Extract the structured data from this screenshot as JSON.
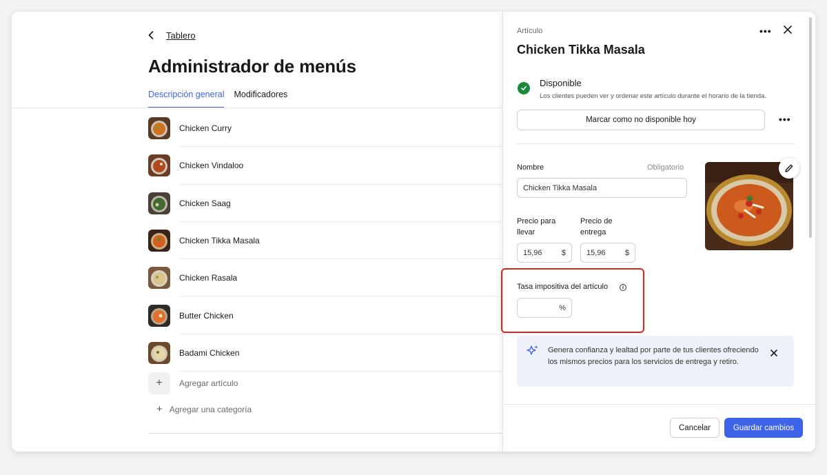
{
  "main": {
    "breadcrumb": "Tablero",
    "title": "Administrador de menús",
    "tabs": [
      {
        "label": "Descripción general",
        "active": true
      },
      {
        "label": "Modificadores",
        "active": false
      }
    ],
    "items": [
      {
        "name": "Chicken Curry"
      },
      {
        "name": "Chicken Vindaloo"
      },
      {
        "name": "Chicken Saag"
      },
      {
        "name": "Chicken Tikka Masala"
      },
      {
        "name": "Chicken Rasala"
      },
      {
        "name": "Butter Chicken"
      },
      {
        "name": "Badami Chicken"
      }
    ],
    "add_item": "Agregar artículo",
    "add_category": "Agregar una categoría"
  },
  "panel": {
    "overline": "Artículo",
    "title": "Chicken Tikka Masala",
    "availability": {
      "title": "Disponible",
      "description": "Los clientes pueden ver y ordenar este artículo durante el horario de la tienda."
    },
    "mark_unavailable_label": "Marcar como no disponible hoy",
    "name_field": {
      "label": "Nombre",
      "required": "Obligatorio",
      "value": "Chicken Tikka Masala"
    },
    "takeout_price": {
      "label_line1": "Precio para",
      "label_line2": "llevar",
      "value": "15,96",
      "suffix": "$"
    },
    "delivery_price": {
      "label_line1": "Precio de",
      "label_line2": "entrega",
      "value": "15,96",
      "suffix": "$"
    },
    "tax_rate": {
      "label": "Tasa impositiva del artículo",
      "value": "",
      "suffix": "%",
      "info_icon": "i"
    },
    "promo_text": "Genera confianza y lealtad por parte de tus clientes ofreciendo los mismos precios para los servicios de entrega y retiro.",
    "cancel_label": "Cancelar",
    "save_label": "Guardar cambios"
  },
  "colors": {
    "accent": "#3e62e6",
    "success": "#1a8a3a",
    "highlight": "#e0241c",
    "promo_bg": "#eef1fa"
  }
}
